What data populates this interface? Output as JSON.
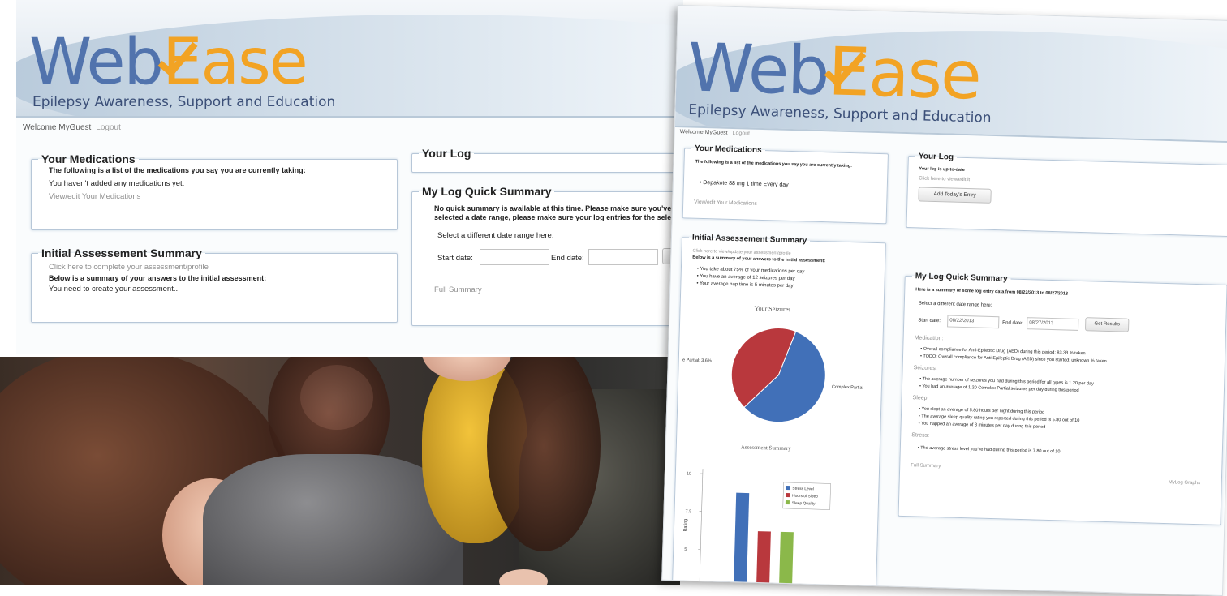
{
  "brand": {
    "web": "Web",
    "ease": "Ease",
    "tagline": "Epilepsy Awareness, Support and Education"
  },
  "left_screen": {
    "welcome": "Welcome MyGuest",
    "logout": "Logout",
    "medications": {
      "title": "Your Medications",
      "intro": "The following is a list of the medications you say you are currently taking:",
      "empty": "You haven't added any medications yet.",
      "link": "View/edit Your Medications"
    },
    "assessment": {
      "title": "Initial Assessement Summary",
      "link": "Click here to complete your assessment/profile",
      "intro": "Below is a summary of your answers to the initial assessment:",
      "note": "You need to create your assessment..."
    },
    "log": {
      "title": "Your Log"
    },
    "quick_summary": {
      "title": "My Log Quick Summary",
      "note_line1": "No quick summary is available at this time. Please make sure you've f",
      "note_line2": "selected a date range, please make sure your log entries for the select",
      "range_label": "Select a different date range here:",
      "start_label": "Start date:",
      "end_label": "End date:",
      "go_label": "Ge",
      "full_summary": "Full Summary"
    }
  },
  "right_screen": {
    "welcome": "Welcome MyGuest",
    "logout": "Logout",
    "medications": {
      "title": "Your Medications",
      "intro": "The following is a list of the medications you say you are currently taking:",
      "items": [
        "Depakote 88 mg 1 time Every day"
      ],
      "link": "View/edit Your Medications"
    },
    "log": {
      "title": "Your Log",
      "status": "Your log is up-to-date",
      "link": "Click here to view/edit it",
      "button": "Add Today's Entry"
    },
    "assessment": {
      "title": "Initial Assessement Summary",
      "link": "Click here to view/update your assessment/profile",
      "intro": "Below is a summary of your answers to the initial assessment:",
      "items": [
        "You take about 75% of your medications per day",
        "You have an average of 12 seizures per day",
        "Your average nap time is 5 minutes per day"
      ],
      "pie_title": "Your Seizures",
      "bar_title": "Assessment Summary",
      "bar_ylabel": "Rating"
    },
    "quick_summary": {
      "title": "My Log Quick Summary",
      "intro": "Here is a summary of some log entry data from 08/22/2013 to 08/27/2013",
      "range_label": "Select a different date range here:",
      "start_label": "Start date:",
      "start_value": "08/22/2013",
      "end_label": "End date:",
      "end_value": "08/27/2013",
      "button": "Get Results",
      "sections": [
        {
          "heading": "Medication:",
          "items": [
            "Overall compliance for Anti-Epileptic Drug (AED) during this period: 83.33 % taken",
            "TODO: Overall compliance for Anti-Epileptic Drug (AED) since you started: unknown % taken"
          ]
        },
        {
          "heading": "Seizures:",
          "items": [
            "The average number of seizures you had during this period for all types is 1.20 per day",
            "You had an average of 1.20 Complex Partial seizures per day during this period"
          ]
        },
        {
          "heading": "Sleep:",
          "items": [
            "You slept an average of 5.80 hours per night during this period",
            "The average sleep quality rating you reported during this period is 5.80 out of 10",
            "You napped an average of 8 minutes per day during this period"
          ]
        },
        {
          "heading": "Stress:",
          "items": [
            "The average stress level you've had during this period is 7.80 out of 10"
          ]
        }
      ],
      "full_summary": "Full Summary",
      "more_link": "MyLog Graphs"
    }
  },
  "chart_data": [
    {
      "type": "pie",
      "title": "Your Seizures",
      "series": [
        {
          "name": "Complex Partial",
          "value": 57,
          "color": "#4170b8"
        },
        {
          "name": "Simple Partial",
          "value": 43,
          "color": "#b9383d"
        }
      ],
      "slice_labels": [
        "Complex Partial",
        "le Partial: 3.6%"
      ]
    },
    {
      "type": "bar",
      "title": "Assessment Summary",
      "ylabel": "Rating",
      "ylim": [
        2.5,
        10
      ],
      "ticks": [
        "10",
        "7.5",
        "5",
        "2.5"
      ],
      "categories": [
        ""
      ],
      "series": [
        {
          "name": "Stress Level",
          "values": [
            8.8
          ],
          "color": "#4170b8"
        },
        {
          "name": "Hours of Sleep",
          "values": [
            6.3
          ],
          "color": "#b9383d"
        },
        {
          "name": "Sleep Quality",
          "values": [
            6.3
          ],
          "color": "#8bb84a"
        }
      ],
      "legend_position": "top-right"
    }
  ]
}
